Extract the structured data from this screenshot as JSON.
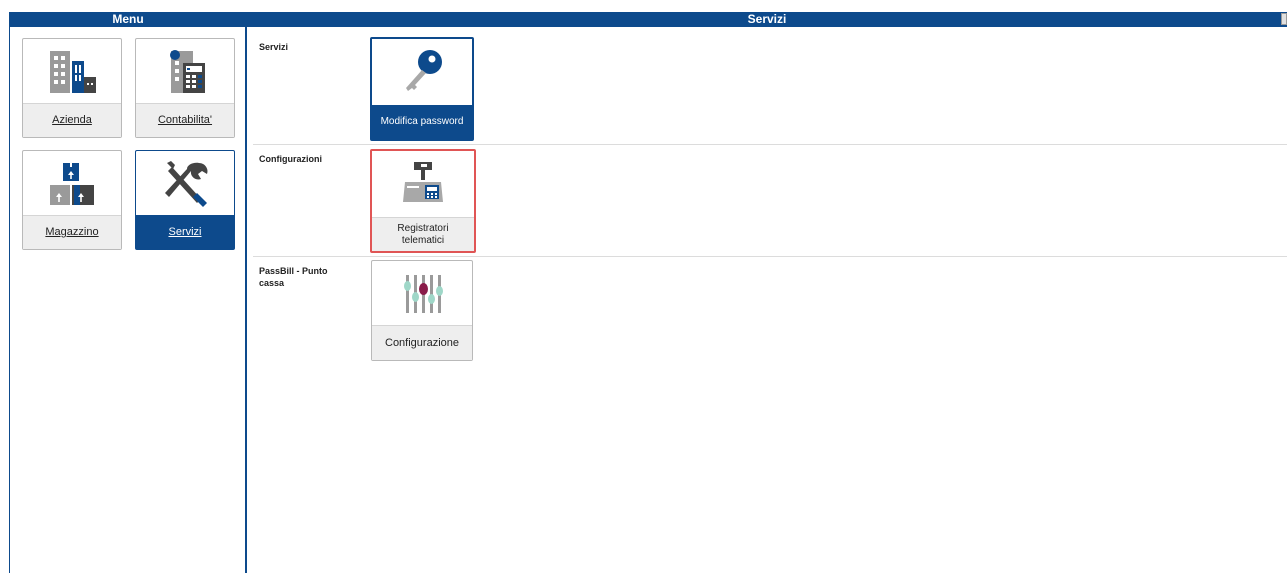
{
  "menu": {
    "title": "Menu",
    "items": [
      {
        "label": "Azienda",
        "icon": "building-icon",
        "active": false
      },
      {
        "label": "Contabilita'",
        "icon": "calculator-icon",
        "active": false
      },
      {
        "label": "Magazzino",
        "icon": "boxes-icon",
        "active": false
      },
      {
        "label": "Servizi",
        "icon": "tools-icon",
        "active": true
      }
    ]
  },
  "servizi": {
    "title": "Servizi",
    "sections": [
      {
        "label": "Servizi",
        "tiles": [
          {
            "label": "Modifica password",
            "icon": "key-icon",
            "style": "primary"
          }
        ]
      },
      {
        "label": "Configurazioni",
        "tiles": [
          {
            "label": "Registratori telematici",
            "icon": "cash-register-icon",
            "style": "highlighted"
          }
        ]
      },
      {
        "label": "PassBill - Punto cassa",
        "tiles": [
          {
            "label": "Configurazione",
            "icon": "sliders-icon",
            "style": "normal"
          }
        ]
      }
    ]
  },
  "colors": {
    "brand": "#0d4a8c",
    "highlight": "#e05555",
    "tile_label_bg": "#eeeeee"
  }
}
